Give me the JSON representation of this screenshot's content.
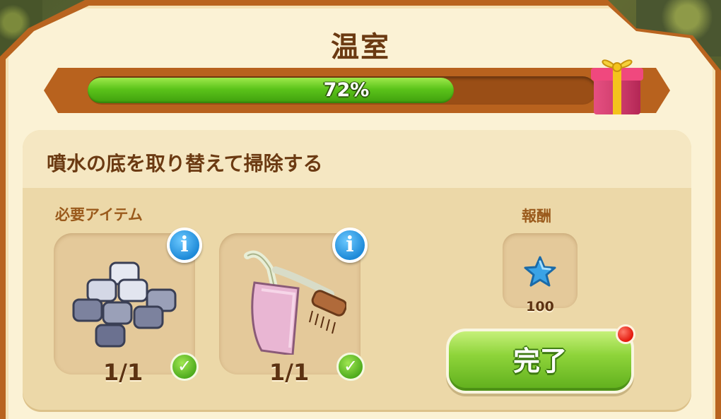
{
  "window": {
    "title": "温室"
  },
  "progress": {
    "value": 0.72,
    "label": "72%"
  },
  "task": {
    "description": "噴水の底を取り替えて掃除する"
  },
  "required": {
    "label": "必要アイテム",
    "items": [
      {
        "icon": "paving-stones-icon",
        "count": "1/1",
        "complete": true
      },
      {
        "icon": "dustpan-brush-icon",
        "count": "1/1",
        "complete": true
      }
    ]
  },
  "reward": {
    "label": "報酬",
    "icon": "blue-star-icon",
    "value": "100"
  },
  "actions": {
    "complete_label": "完了"
  },
  "colors": {
    "frame": "#b9641f",
    "panel": "#fbf2d5",
    "progress_fill": "#5bc31a",
    "button": "#8ed43a",
    "info": "#1e8ad8",
    "notify": "#e3180c"
  }
}
